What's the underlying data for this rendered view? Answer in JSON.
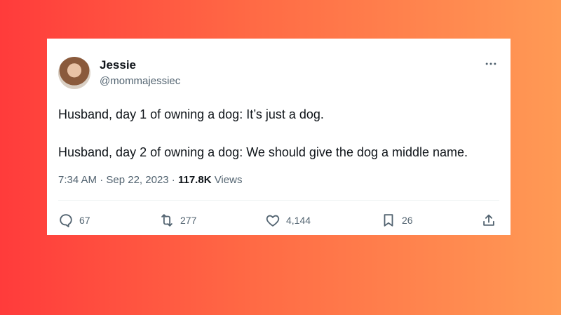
{
  "author": {
    "name": "Jessie",
    "handle": "@mommajessiec"
  },
  "tweet": {
    "lines": [
      "Husband, day 1 of owning a dog: It’s just a dog.",
      "Husband, day 2 of owning a dog: We should give the dog a middle name."
    ]
  },
  "meta": {
    "time": "7:34 AM",
    "sep1": " · ",
    "date": "Sep 22, 2023",
    "sep2": " · ",
    "views_count": "117.8K",
    "views_label": " Views"
  },
  "actions": {
    "replies": "67",
    "reposts": "277",
    "likes": "4,144",
    "bookmarks": "26"
  },
  "icons": {
    "more": "more-icon",
    "reply": "reply-icon",
    "repost": "repost-icon",
    "like": "heart-icon",
    "bookmark": "bookmark-icon",
    "share": "share-icon"
  },
  "colors": {
    "text": "#0f1419",
    "secondary": "#536471",
    "background_left": "#ff3b3b",
    "background_right": "#ff9a55"
  }
}
